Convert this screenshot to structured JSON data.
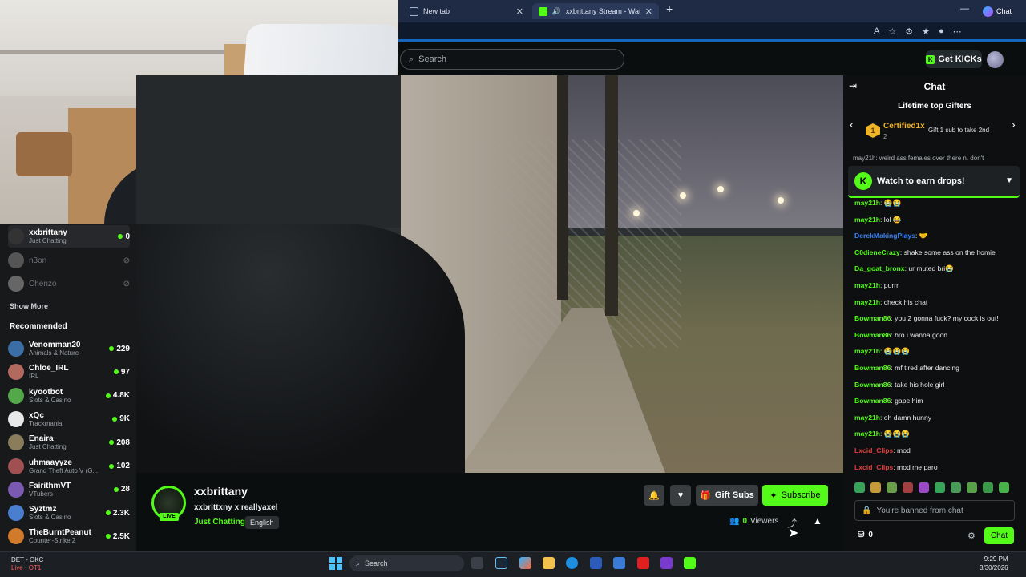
{
  "browser": {
    "tabs": [
      {
        "label": "New tab",
        "active": false
      },
      {
        "label": "xxbrittany Stream - Watch Live",
        "active": true
      }
    ],
    "new_tab_symbol": "+",
    "copilot_label": "Chat"
  },
  "header": {
    "search_placeholder": "Search",
    "get_kicks_label": "Get KICKs"
  },
  "sidebar": {
    "following": [
      {
        "name": "xxbrittany",
        "category": "Just Chatting",
        "viewers": "0",
        "live": true,
        "avatar_color": "#333"
      },
      {
        "name": "n3on",
        "category": "",
        "viewers": "",
        "live": false,
        "avatar_color": "#555"
      },
      {
        "name": "Chenzo",
        "category": "",
        "viewers": "",
        "live": false,
        "avatar_color": "#666"
      }
    ],
    "show_more_label": "Show More",
    "recommended_heading": "Recommended",
    "recommended": [
      {
        "name": "Venomman20",
        "category": "Animals & Nature",
        "viewers": "229",
        "avatar_color": "#3b6ea5"
      },
      {
        "name": "Chloe_IRL",
        "category": "IRL",
        "viewers": "97",
        "avatar_color": "#b36a5e"
      },
      {
        "name": "kyootbot",
        "category": "Slots & Casino",
        "viewers": "4.8K",
        "avatar_color": "#53a84a"
      },
      {
        "name": "xQc",
        "category": "Trackmania",
        "viewers": "9K",
        "avatar_color": "#e8e8e8"
      },
      {
        "name": "Enaira",
        "category": "Just Chatting",
        "viewers": "208",
        "avatar_color": "#8a7d5c"
      },
      {
        "name": "uhmaayyze",
        "category": "Grand Theft Auto V (G...",
        "viewers": "102",
        "avatar_color": "#a05050"
      },
      {
        "name": "FairithmVT",
        "category": "VTubers",
        "viewers": "28",
        "avatar_color": "#7a5ab0"
      },
      {
        "name": "Syztmz",
        "category": "Slots & Casino",
        "viewers": "2.3K",
        "avatar_color": "#4a7fd0"
      },
      {
        "name": "TheBurntPeanut",
        "category": "Counter-Strike 2",
        "viewers": "2.5K",
        "avatar_color": "#d07a2a"
      }
    ]
  },
  "stream": {
    "name": "xxbrittany",
    "title": "xxbrittxny x reallyaxel",
    "category": "Just Chatting",
    "language": "English",
    "live_label": "LIVE",
    "gift_subs_label": "Gift Subs",
    "subscribe_label": "Subscribe",
    "viewers_count": "0",
    "viewers_label": "Viewers"
  },
  "chat": {
    "title": "Chat",
    "gifters_title": "Lifetime top Gifters",
    "top_gifter": {
      "rank": "1",
      "name": "Certified1x",
      "count": "2"
    },
    "gift_hint": "Gift 1 sub to take 2nd",
    "peek_message": "may21h: weird ass females over there n. don't",
    "drops_label": "Watch to earn drops!",
    "messages": [
      {
        "user": "may21h",
        "text": "😭😭",
        "color": "#53fc18"
      },
      {
        "user": "may21h",
        "text": "lol 😂",
        "color": "#53fc18"
      },
      {
        "user": "DerekMakingPlays",
        "text": "🤝",
        "color": "#3b82f6"
      },
      {
        "user": "C0dieneCrazy",
        "text": "shake some ass on the homie",
        "color": "#53fc18"
      },
      {
        "user": "Da_goat_bronx",
        "text": "ur muted bri😭",
        "color": "#53fc18"
      },
      {
        "user": "may21h",
        "text": "purrr",
        "color": "#53fc18"
      },
      {
        "user": "may21h",
        "text": "check his chat",
        "color": "#53fc18"
      },
      {
        "user": "Bowman86",
        "text": "you 2 gonna fuck? my cock is out!",
        "color": "#53fc18"
      },
      {
        "user": "Bowman86",
        "text": "bro i wanna goon",
        "color": "#53fc18"
      },
      {
        "user": "may21h",
        "text": "😭😭😭",
        "color": "#53fc18"
      },
      {
        "user": "Bowman86",
        "text": "mf tired after dancing",
        "color": "#53fc18"
      },
      {
        "user": "Bowman86",
        "text": "take his hole girl",
        "color": "#53fc18"
      },
      {
        "user": "Bowman86",
        "text": "gape him",
        "color": "#53fc18"
      },
      {
        "user": "may21h",
        "text": "oh damn hunny",
        "color": "#53fc18"
      },
      {
        "user": "may21h",
        "text": "😭😭😭",
        "color": "#53fc18"
      },
      {
        "user": "Lxcid_Clips",
        "text": "mod",
        "color": "#e03c3c"
      },
      {
        "user": "Lxcid_Clips",
        "text": "mod me paro",
        "color": "#e03c3c"
      }
    ],
    "banned_text": "You're banned from chat",
    "points": "0",
    "send_label": "Chat"
  },
  "taskbar": {
    "weather_title": "DET - OKC",
    "weather_sub": "Live · OT1",
    "search_label": "Search",
    "time": "9:29 PM",
    "date": "3/30/2026"
  },
  "colors": {
    "accent": "#53fc18",
    "background": "#0b0e0f"
  }
}
